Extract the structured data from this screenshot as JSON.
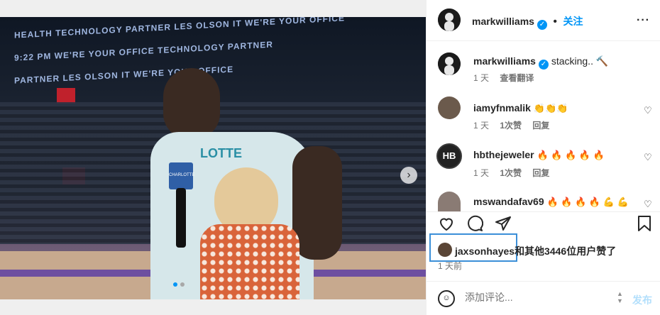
{
  "post": {
    "banner_top": "HEALTH TECHNOLOGY PARTNER   LES OLSON IT   WE'RE YOUR OFFICE",
    "banner_mid": "9:22 PM   WE'RE YOUR OFFICE TECHNOLOGY PARTNER",
    "banner_low": "PARTNER   LES OLSON IT   WE'RE YOUR OFFICE",
    "jersey_text": "LOTTE",
    "mic_flag": "CHARLOTTE",
    "carousel_index": 1,
    "carousel_count": 2
  },
  "header": {
    "username": "markwilliams",
    "follow_label": "关注",
    "more_label": "···"
  },
  "caption": {
    "username": "markwilliams",
    "text": "stacking.. 🔨",
    "time": "1 天",
    "translate": "查看翻译"
  },
  "comments": [
    {
      "username": "iamyfnmalik",
      "text": "👏👏👏",
      "time": "1 天",
      "likes": "1次赞",
      "reply": "回复"
    },
    {
      "username": "hbthejeweler",
      "text": "🔥 🔥 🔥 🔥 🔥",
      "time": "1 天",
      "likes": "1次赞",
      "reply": "回复"
    },
    {
      "username": "mswandafav69",
      "text": "🔥 🔥 🔥 🔥 💪 💪",
      "time": "",
      "likes": "",
      "reply": ""
    }
  ],
  "actions": {
    "like_icon": "heart-icon",
    "comment_icon": "comment-icon",
    "share_icon": "share-icon",
    "save_icon": "bookmark-icon"
  },
  "likes": {
    "username": "jaxsonhayes",
    "rest": "和其他3446位用户赞了",
    "time": "1 天前"
  },
  "comment_box": {
    "placeholder": "添加评论...",
    "post_label": "发布"
  },
  "colors": {
    "accent": "#0095f6",
    "highlight_box": "#3b8fd8",
    "post_disabled": "#b2dffc"
  }
}
